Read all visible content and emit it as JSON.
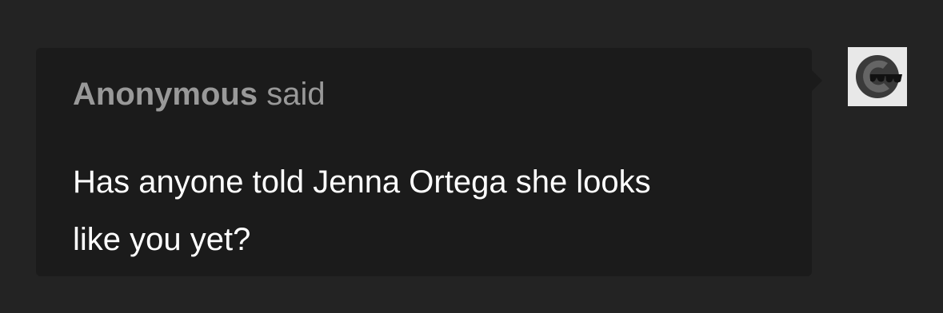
{
  "ask": {
    "asker_name": "Anonymous",
    "said_label": "said",
    "question": "Has anyone told Jenna Ortega she looks like you yet?"
  },
  "avatar": {
    "icon": "anonymous-sunglasses-avatar-icon"
  },
  "colors": {
    "page_background": "#232323",
    "bubble_background": "#1b1b1b",
    "asker_text": "#999999",
    "question_text": "#ffffff",
    "avatar_background": "#e8e8e8"
  }
}
